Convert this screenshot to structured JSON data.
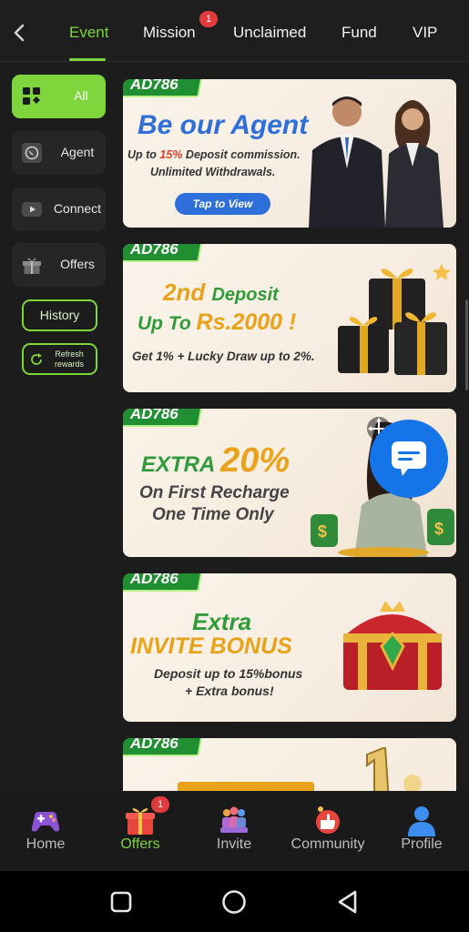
{
  "header": {
    "tabs": [
      {
        "label": "Event",
        "active": true
      },
      {
        "label": "Mission",
        "badge": "1"
      },
      {
        "label": "Unclaimed"
      },
      {
        "label": "Fund"
      },
      {
        "label": "VIP"
      }
    ]
  },
  "sidebar": {
    "items": [
      {
        "label": "All",
        "icon": "grid-icon",
        "active": true
      },
      {
        "label": "Agent",
        "icon": "whatsapp-icon"
      },
      {
        "label": "Connect",
        "icon": "youtube-icon"
      },
      {
        "label": "Offers",
        "icon": "gift-icon"
      }
    ],
    "history_label": "History",
    "refresh_label": "Refresh rewards"
  },
  "banners": [
    {
      "tag": "AD786",
      "title": "Be our Agent",
      "line1_prefix": "Up to ",
      "line1_highlight": "15%",
      "line1_suffix": " Deposit commission.",
      "line2": "Unlimited Withdrawals.",
      "button": "Tap to View"
    },
    {
      "tag": "AD786",
      "title_a": "2nd ",
      "title_b": "Deposit",
      "line1_a": "Up To ",
      "line1_b": "Rs.2000 !",
      "line2": "Get 1% + Lucky Draw up to 2%."
    },
    {
      "tag": "AD786",
      "title_a": "EXTRA ",
      "title_b": "20%",
      "line1": "On First Recharge",
      "line2": "One Time Only"
    },
    {
      "tag": "AD786",
      "title_a": "Extra",
      "title_b": "INVITE BONUS",
      "line1": "Deposit up to 15%bonus",
      "line2": "+ Extra bonus!"
    },
    {
      "tag": "AD786"
    }
  ],
  "bottom_nav": [
    {
      "label": "Home",
      "icon": "gamepad-icon"
    },
    {
      "label": "Offers",
      "icon": "gift-box-icon",
      "active": true,
      "badge": "1"
    },
    {
      "label": "Invite",
      "icon": "people-icon"
    },
    {
      "label": "Community",
      "icon": "community-icon"
    },
    {
      "label": "Profile",
      "icon": "profile-icon"
    }
  ],
  "colors": {
    "accent": "#7cd63a",
    "badge": "#e23b3b",
    "brand_green": "#1f8f32",
    "banner_bg": "#f8efe4"
  }
}
